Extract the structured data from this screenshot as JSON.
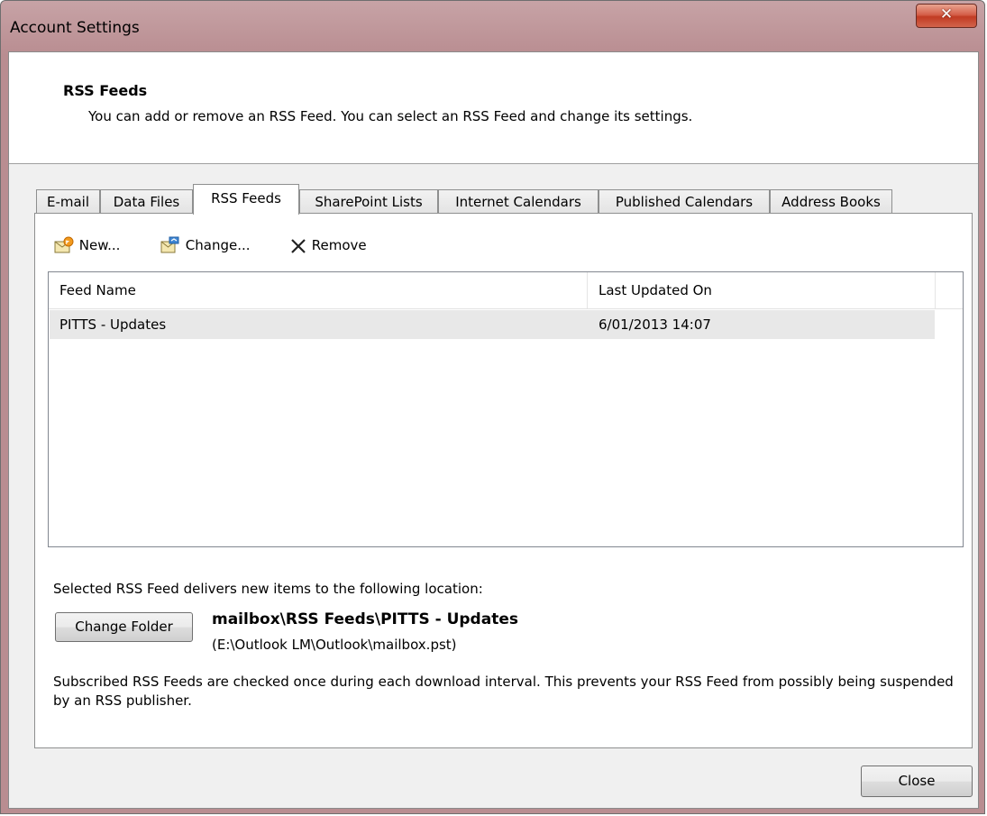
{
  "window": {
    "title": "Account Settings"
  },
  "header": {
    "title": "RSS Feeds",
    "subtitle": "You can add or remove an RSS Feed. You can select an RSS Feed and change its settings."
  },
  "tabs": [
    {
      "label": "E-mail"
    },
    {
      "label": "Data Files"
    },
    {
      "label": "RSS Feeds",
      "active": true
    },
    {
      "label": "SharePoint Lists"
    },
    {
      "label": "Internet Calendars"
    },
    {
      "label": "Published Calendars"
    },
    {
      "label": "Address Books"
    }
  ],
  "toolbar": {
    "new_label": "New...",
    "change_label": "Change...",
    "remove_label": "Remove"
  },
  "table": {
    "columns": [
      "Feed Name",
      "Last Updated On"
    ],
    "rows": [
      {
        "name": "PITTS - Updates",
        "updated": "6/01/2013 14:07"
      }
    ]
  },
  "location": {
    "label": "Selected RSS Feed delivers new items to the following location:",
    "button": "Change Folder",
    "folder": "mailbox\\RSS Feeds\\PITTS - Updates",
    "path": "(E:\\Outlook LM\\Outlook\\mailbox.pst)"
  },
  "note": "Subscribed RSS Feeds are checked once during each download interval. This prevents your RSS Feed from possibly being suspended by an RSS publisher.",
  "footer": {
    "close_label": "Close"
  }
}
